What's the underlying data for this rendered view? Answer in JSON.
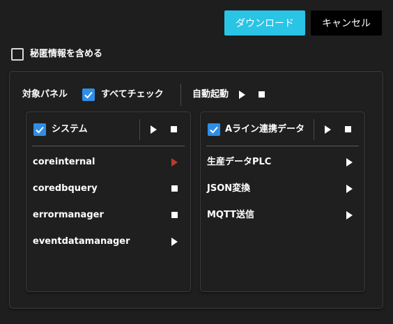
{
  "toolbar": {
    "download_label": "ダウンロード",
    "cancel_label": "キャンセル"
  },
  "options": {
    "include_secrets_label": "秘匿情報を含める",
    "include_secrets_checked": false
  },
  "header": {
    "target_panel_label": "対象パネル",
    "check_all_label": "すべてチェック",
    "check_all_checked": true,
    "autostart_label": "自動起動"
  },
  "panels": [
    {
      "title": "システム",
      "checked": true,
      "items": [
        {
          "label": "coreinternal",
          "action": "play-red"
        },
        {
          "label": "coredbquery",
          "action": "stop"
        },
        {
          "label": "errormanager",
          "action": "stop"
        },
        {
          "label": "eventdatamanager",
          "action": "play"
        }
      ]
    },
    {
      "title": "Aライン連携データ",
      "checked": true,
      "items": [
        {
          "label": "生産データPLC",
          "action": "play"
        },
        {
          "label": "JSON変換",
          "action": "play"
        },
        {
          "label": "MQTT送信",
          "action": "play"
        }
      ]
    }
  ],
  "colors": {
    "accent": "#29c4e6",
    "checkbox": "#2f8ee8",
    "running": "#c0392b",
    "background": "#1e1e1e"
  }
}
